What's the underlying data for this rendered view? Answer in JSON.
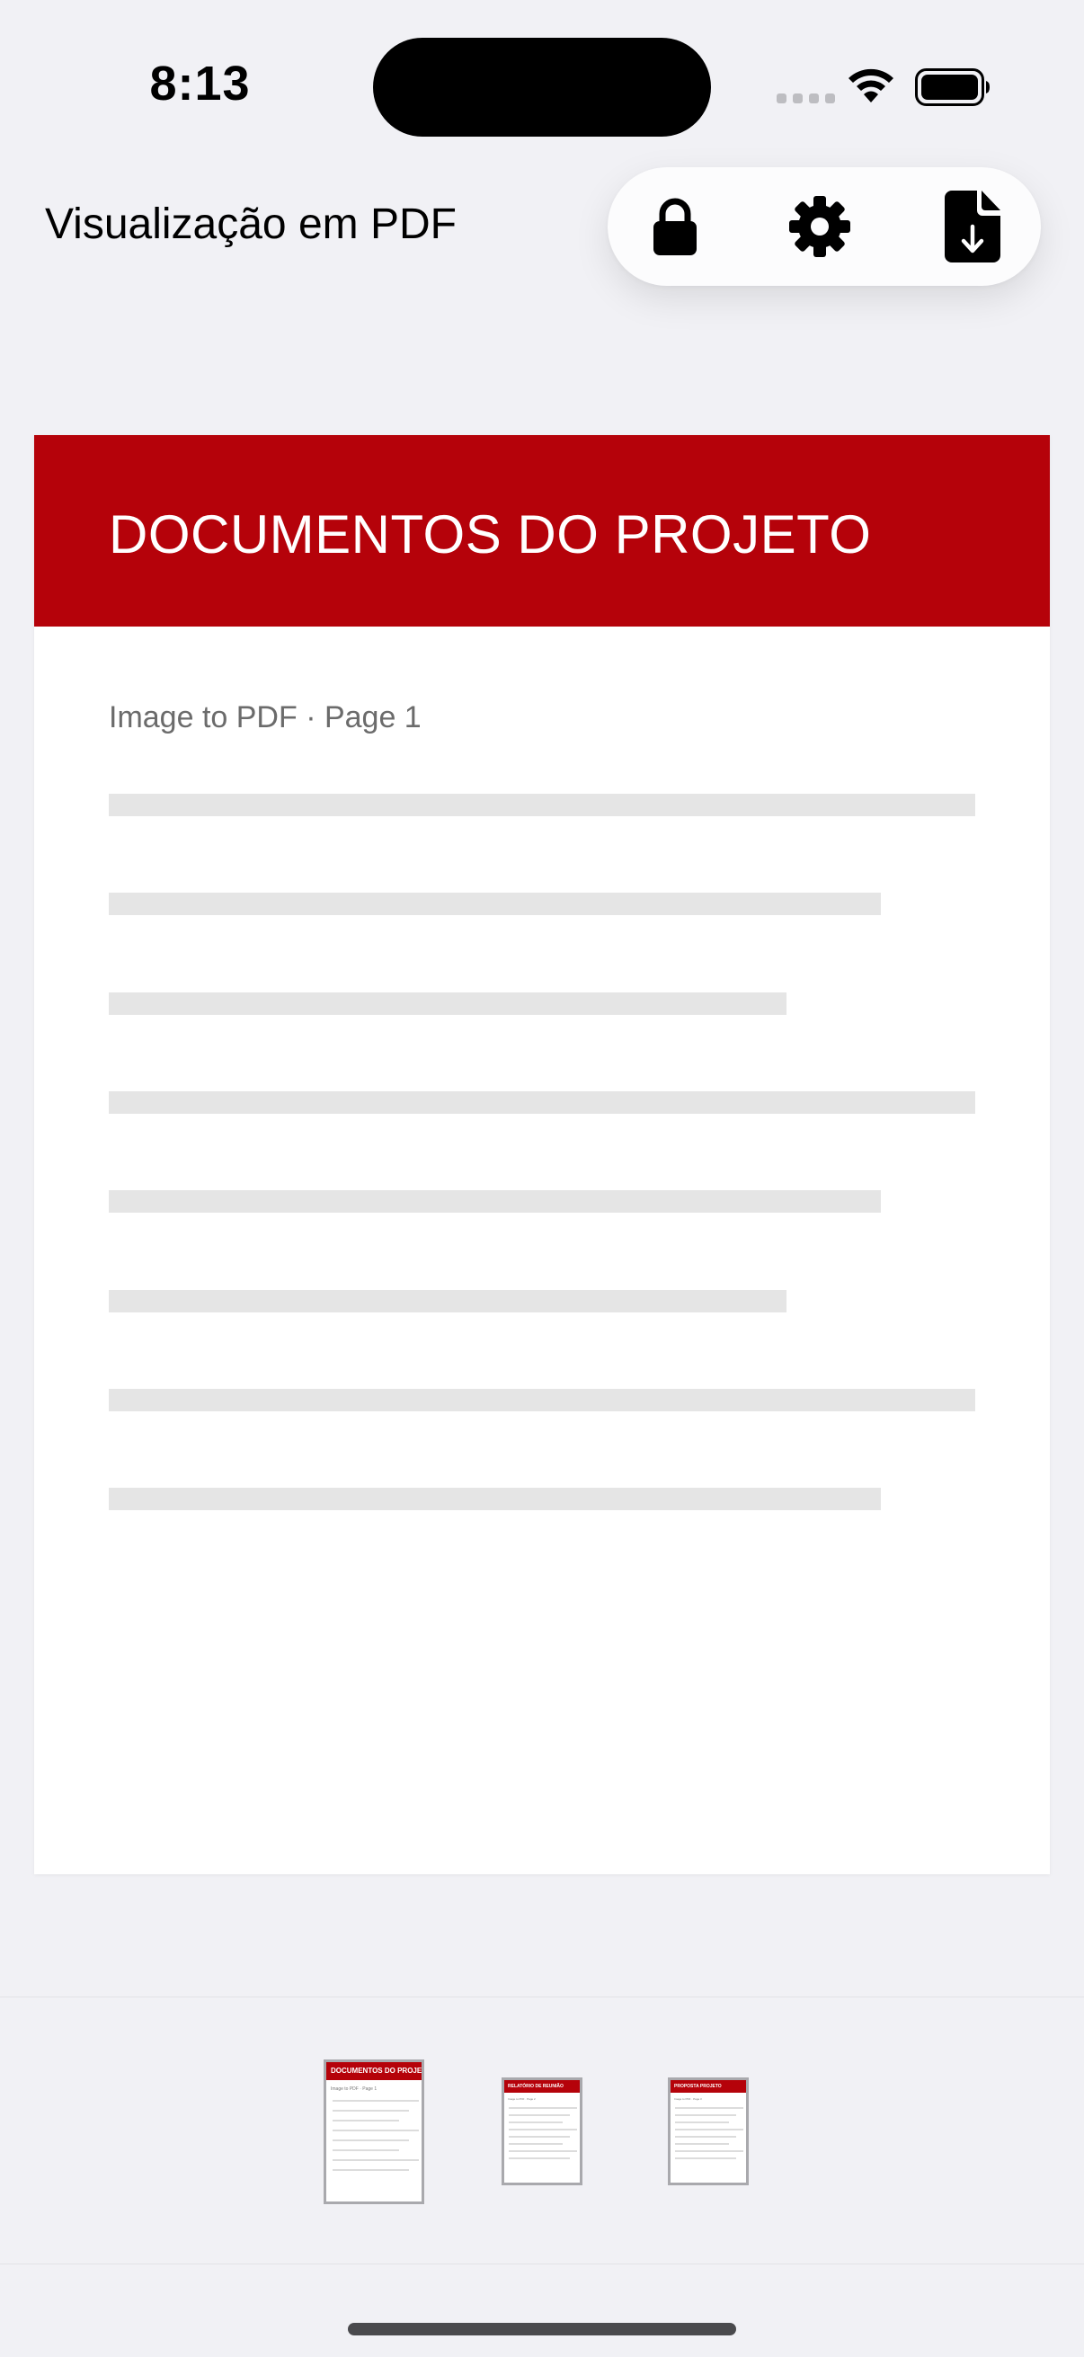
{
  "status_bar": {
    "time": "8:13"
  },
  "nav": {
    "title": "Visualização em PDF",
    "actions": [
      {
        "id": "lock",
        "icon": "lock-icon"
      },
      {
        "id": "settings",
        "icon": "gear-icon"
      },
      {
        "id": "export",
        "icon": "document-download-icon"
      }
    ]
  },
  "pdf_page": {
    "title": "DOCUMENTOS DO PROJETO",
    "subtitle": "Image to PDF · Page 1",
    "accent_color": "#b5020a"
  },
  "thumbnails": [
    {
      "title": "DOCUMENTOS DO PROJETO",
      "subtitle": "Image to PDF · Page 1",
      "selected": true
    },
    {
      "title": "RELATÓRIO DE REUNIÃO",
      "subtitle": "Image to PDF · Page 2",
      "selected": false
    },
    {
      "title": "PROPOSTA PROJETO",
      "subtitle": "Image to PDF · Page 3",
      "selected": false
    }
  ]
}
